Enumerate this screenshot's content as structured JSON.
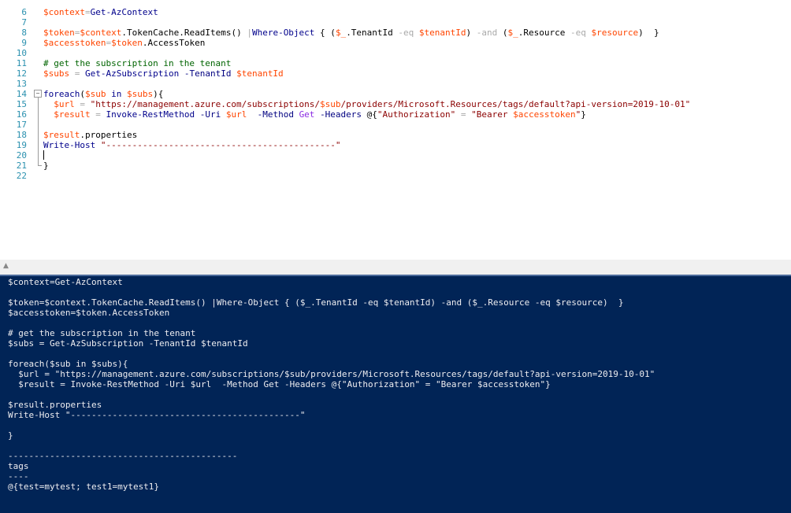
{
  "editor": {
    "lines": [
      {
        "num": "6",
        "tokens": [
          {
            "t": "$context",
            "c": "v"
          },
          {
            "t": "=",
            "c": "o"
          },
          {
            "t": "Get-AzContext",
            "c": "k"
          }
        ]
      },
      {
        "num": "7",
        "tokens": []
      },
      {
        "num": "8",
        "tokens": [
          {
            "t": "$token",
            "c": "v"
          },
          {
            "t": "=",
            "c": "o"
          },
          {
            "t": "$context",
            "c": "v"
          },
          {
            "t": ".TokenCache.",
            "c": "t"
          },
          {
            "t": "ReadItems",
            "c": "t"
          },
          {
            "t": "() ",
            "c": "t"
          },
          {
            "t": "|",
            "c": "o"
          },
          {
            "t": "Where-Object",
            "c": "k"
          },
          {
            "t": " { (",
            "c": "t"
          },
          {
            "t": "$_",
            "c": "v"
          },
          {
            "t": ".TenantId ",
            "c": "t"
          },
          {
            "t": "-eq",
            "c": "o"
          },
          {
            "t": " ",
            "c": "t"
          },
          {
            "t": "$tenantId",
            "c": "v"
          },
          {
            "t": ") ",
            "c": "t"
          },
          {
            "t": "-and",
            "c": "o"
          },
          {
            "t": " (",
            "c": "t"
          },
          {
            "t": "$_",
            "c": "v"
          },
          {
            "t": ".Resource ",
            "c": "t"
          },
          {
            "t": "-eq",
            "c": "o"
          },
          {
            "t": " ",
            "c": "t"
          },
          {
            "t": "$resource",
            "c": "v"
          },
          {
            "t": ")  }",
            "c": "t"
          }
        ]
      },
      {
        "num": "9",
        "tokens": [
          {
            "t": "$accesstoken",
            "c": "v"
          },
          {
            "t": "=",
            "c": "o"
          },
          {
            "t": "$token",
            "c": "v"
          },
          {
            "t": ".AccessToken",
            "c": "t"
          }
        ]
      },
      {
        "num": "10",
        "tokens": []
      },
      {
        "num": "11",
        "tokens": [
          {
            "t": "# get the subscription in the tenant",
            "c": "c"
          }
        ]
      },
      {
        "num": "12",
        "tokens": [
          {
            "t": "$subs",
            "c": "v"
          },
          {
            "t": " = ",
            "c": "o"
          },
          {
            "t": "Get-AzSubscription",
            "c": "k"
          },
          {
            "t": " ",
            "c": "t"
          },
          {
            "t": "-TenantId",
            "c": "p"
          },
          {
            "t": " ",
            "c": "t"
          },
          {
            "t": "$tenantId",
            "c": "v"
          }
        ]
      },
      {
        "num": "13",
        "tokens": []
      },
      {
        "num": "14",
        "tokens": [
          {
            "t": "foreach",
            "c": "k"
          },
          {
            "t": "(",
            "c": "t"
          },
          {
            "t": "$sub",
            "c": "v"
          },
          {
            "t": " in ",
            "c": "k"
          },
          {
            "t": "$subs",
            "c": "v"
          },
          {
            "t": "){",
            "c": "t"
          }
        ]
      },
      {
        "num": "15",
        "tokens": [
          {
            "t": "  ",
            "c": "t"
          },
          {
            "t": "$url",
            "c": "v"
          },
          {
            "t": " = ",
            "c": "o"
          },
          {
            "t": "\"https://management.azure.com/subscriptions/",
            "c": "s"
          },
          {
            "t": "$sub",
            "c": "v"
          },
          {
            "t": "/providers/Microsoft.Resources/tags/default?api-version=2019-10-01\"",
            "c": "s"
          }
        ]
      },
      {
        "num": "16",
        "tokens": [
          {
            "t": "  ",
            "c": "t"
          },
          {
            "t": "$result",
            "c": "v"
          },
          {
            "t": " = ",
            "c": "o"
          },
          {
            "t": "Invoke-RestMethod",
            "c": "k"
          },
          {
            "t": " ",
            "c": "t"
          },
          {
            "t": "-Uri",
            "c": "p"
          },
          {
            "t": " ",
            "c": "t"
          },
          {
            "t": "$url",
            "c": "v"
          },
          {
            "t": "  ",
            "c": "t"
          },
          {
            "t": "-Method",
            "c": "p"
          },
          {
            "t": " ",
            "c": "t"
          },
          {
            "t": "Get",
            "c": "m"
          },
          {
            "t": " ",
            "c": "t"
          },
          {
            "t": "-Headers",
            "c": "p"
          },
          {
            "t": " @{",
            "c": "t"
          },
          {
            "t": "\"Authorization\"",
            "c": "s"
          },
          {
            "t": " = ",
            "c": "o"
          },
          {
            "t": "\"Bearer ",
            "c": "s"
          },
          {
            "t": "$accesstoken",
            "c": "v"
          },
          {
            "t": "\"",
            "c": "s"
          },
          {
            "t": "}",
            "c": "t"
          }
        ]
      },
      {
        "num": "17",
        "tokens": []
      },
      {
        "num": "18",
        "tokens": [
          {
            "t": "$result",
            "c": "v"
          },
          {
            "t": ".properties",
            "c": "t"
          }
        ]
      },
      {
        "num": "19",
        "tokens": [
          {
            "t": "Write-Host",
            "c": "k"
          },
          {
            "t": " ",
            "c": "t"
          },
          {
            "t": "\"--------------------------------------------\"",
            "c": "s"
          }
        ]
      },
      {
        "num": "20",
        "tokens": []
      },
      {
        "num": "21",
        "tokens": [
          {
            "t": "}",
            "c": "t"
          }
        ]
      },
      {
        "num": "22",
        "tokens": []
      }
    ]
  },
  "console": {
    "lines": [
      "$context=Get-AzContext",
      "",
      "$token=$context.TokenCache.ReadItems() |Where-Object { ($_.TenantId -eq $tenantId) -and ($_.Resource -eq $resource)  }",
      "$accesstoken=$token.AccessToken",
      "",
      "# get the subscription in the tenant",
      "$subs = Get-AzSubscription -TenantId $tenantId",
      "",
      "foreach($sub in $subs){",
      "  $url = \"https://management.azure.com/subscriptions/$sub/providers/Microsoft.Resources/tags/default?api-version=2019-10-01\"",
      "  $result = Invoke-RestMethod -Uri $url  -Method Get -Headers @{\"Authorization\" = \"Bearer $accesstoken\"}",
      "",
      "$result.properties",
      "Write-Host \"--------------------------------------------\"",
      "",
      "}",
      "",
      "--------------------------------------------",
      "tags",
      "----",
      "@{test=mytest; test1=mytest1}"
    ]
  }
}
